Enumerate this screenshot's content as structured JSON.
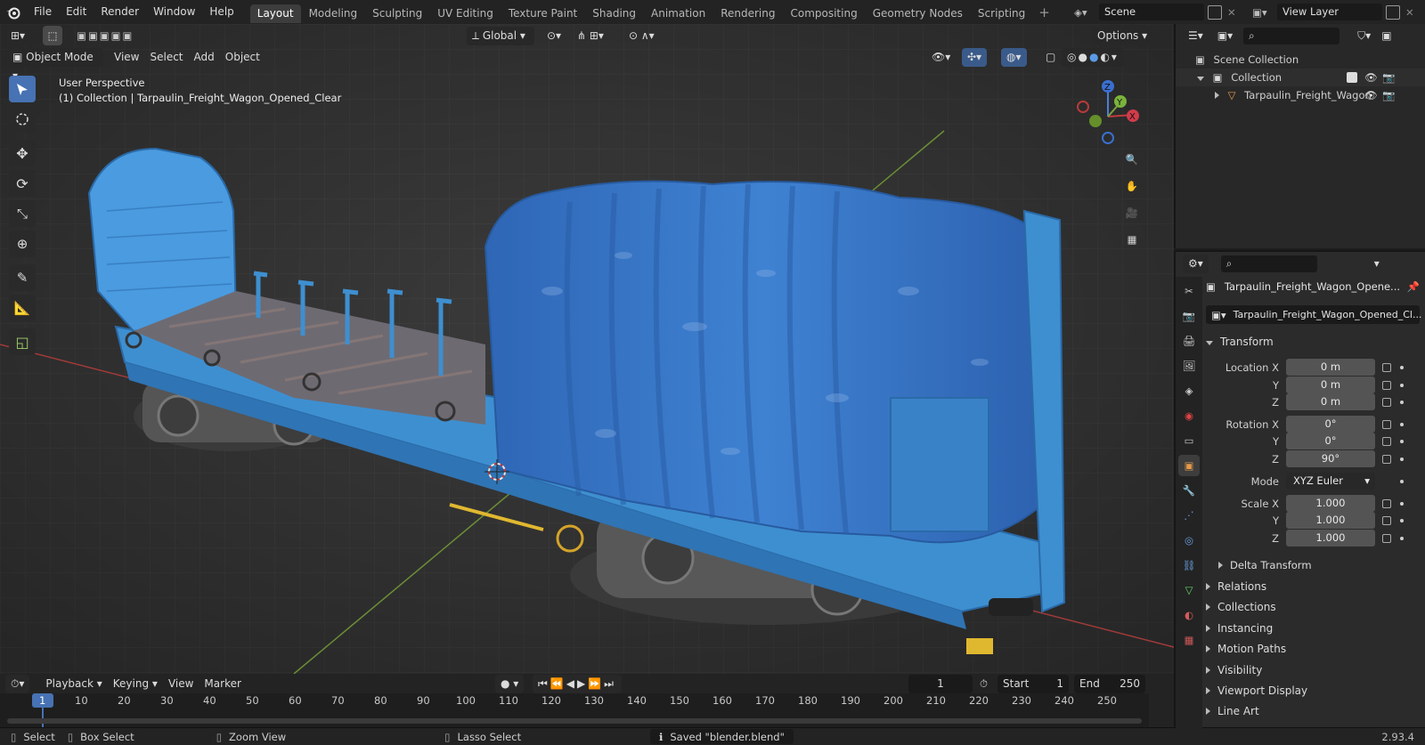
{
  "topbar": {
    "menus": [
      "File",
      "Edit",
      "Render",
      "Window",
      "Help"
    ],
    "workspaces": [
      "Layout",
      "Modeling",
      "Sculpting",
      "UV Editing",
      "Texture Paint",
      "Shading",
      "Animation",
      "Rendering",
      "Compositing",
      "Geometry Nodes",
      "Scripting"
    ],
    "active_workspace": "Layout",
    "scene_name": "Scene",
    "view_layer": "View Layer"
  },
  "viewport": {
    "mode": "Object Mode",
    "menus": [
      "View",
      "Select",
      "Add",
      "Object"
    ],
    "transform_orientation": "Global",
    "options_label": "Options",
    "overlay_line1": "User Perspective",
    "overlay_line2": "(1) Collection | Tarpaulin_Freight_Wagon_Opened_Clear",
    "gizmo_axes": {
      "x": "X",
      "y": "Y",
      "z": "Z"
    },
    "colors": {
      "wagon_body": "#3e8fd0",
      "tarp": "#3a78c8",
      "rail": "#2c2c2c",
      "x_axis": "#c23b3b",
      "y_axis": "#7aa33b"
    }
  },
  "timeline": {
    "menus": [
      "Playback",
      "Keying",
      "View",
      "Marker"
    ],
    "current_frame": "1",
    "start_label": "Start",
    "start_value": "1",
    "end_label": "End",
    "end_value": "250",
    "ticks": [
      "1",
      "10",
      "20",
      "30",
      "40",
      "50",
      "60",
      "70",
      "80",
      "90",
      "100",
      "110",
      "120",
      "130",
      "140",
      "150",
      "160",
      "170",
      "180",
      "190",
      "200",
      "210",
      "220",
      "230",
      "240",
      "250"
    ]
  },
  "statusbar": {
    "select": "Select",
    "box_select": "Box Select",
    "zoom_view": "Zoom View",
    "lasso_select": "Lasso Select",
    "message": "Saved \"blender.blend\"",
    "version": "2.93.4"
  },
  "outliner": {
    "scene_collection": "Scene Collection",
    "collection": "Collection",
    "object": "Tarpaulin_Freight_Wagon"
  },
  "properties": {
    "object_name": "Tarpaulin_Freight_Wagon_Opene...",
    "object_data_name": "Tarpaulin_Freight_Wagon_Opened_Cl...",
    "transform_label": "Transform",
    "location_x_label": "Location X",
    "location_x": "0 m",
    "location_y_label": "Y",
    "location_y": "0 m",
    "location_z_label": "Z",
    "location_z": "0 m",
    "rotation_x_label": "Rotation X",
    "rotation_x": "0°",
    "rotation_y_label": "Y",
    "rotation_y": "0°",
    "rotation_z_label": "Z",
    "rotation_z": "90°",
    "mode_label": "Mode",
    "mode_value": "XYZ Euler",
    "scale_x_label": "Scale X",
    "scale_x": "1.000",
    "scale_y_label": "Y",
    "scale_y": "1.000",
    "scale_z_label": "Z",
    "scale_z": "1.000",
    "delta_transform": "Delta Transform",
    "panels": [
      "Relations",
      "Collections",
      "Instancing",
      "Motion Paths",
      "Visibility",
      "Viewport Display",
      "Line Art"
    ]
  }
}
